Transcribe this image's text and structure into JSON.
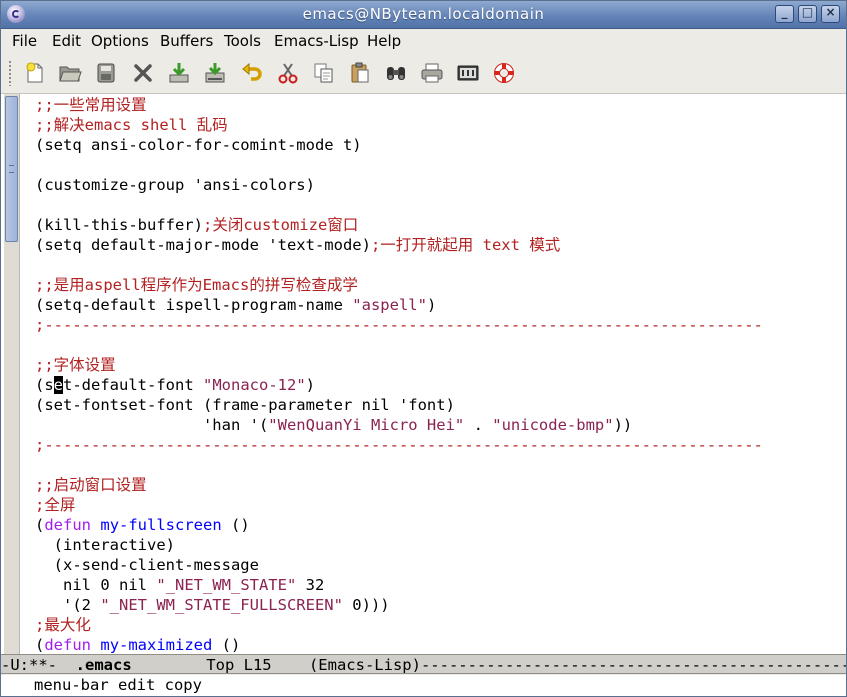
{
  "window": {
    "title": "emacs@NByteam.localdomain"
  },
  "menubar": [
    "File",
    "Edit",
    "Options",
    "Buffers",
    "Tools",
    "Emacs-Lisp",
    "Help"
  ],
  "toolbar": [
    {
      "name": "new-file-icon"
    },
    {
      "name": "open-folder-icon"
    },
    {
      "name": "save-icon"
    },
    {
      "name": "close-icon"
    },
    {
      "name": "save-download-icon"
    },
    {
      "name": "save-as-icon"
    },
    {
      "name": "undo-icon"
    },
    {
      "name": "cut-icon"
    },
    {
      "name": "copy-icon"
    },
    {
      "name": "paste-icon"
    },
    {
      "name": "search-binoculars-icon"
    },
    {
      "name": "print-icon"
    },
    {
      "name": "preferences-icon"
    },
    {
      "name": "help-lifebuoy-icon"
    }
  ],
  "code_lines": [
    [
      {
        "t": ";;一些常用设置",
        "c": "c"
      }
    ],
    [
      {
        "t": ";;解决emacs shell 乱码",
        "c": "c"
      }
    ],
    [
      {
        "t": "(setq ansi-color-for-comint-mode t)",
        "c": ""
      }
    ],
    [],
    [
      {
        "t": "(customize-group 'ansi-colors)",
        "c": ""
      }
    ],
    [],
    [
      {
        "t": "(kill-this-buffer)",
        "c": ""
      },
      {
        "t": ";关闭customize窗口",
        "c": "c"
      }
    ],
    [
      {
        "t": "(setq default-major-mode 'text-mode)",
        "c": ""
      },
      {
        "t": ";一打开就起用 text 模式",
        "c": "c"
      }
    ],
    [],
    [
      {
        "t": ";;是用aspell程序作为Emacs的拼写检查成学",
        "c": "c"
      }
    ],
    [
      {
        "t": "(setq-default ispell-program-name ",
        "c": ""
      },
      {
        "t": "\"aspell\"",
        "c": "s"
      },
      {
        "t": ")",
        "c": ""
      }
    ],
    [
      {
        "t": ";-----------------------------------------------------------------------------",
        "c": "c"
      }
    ],
    [],
    [
      {
        "t": ";;字体设置",
        "c": "c"
      }
    ],
    [
      {
        "t": "(s",
        "c": ""
      },
      {
        "t": "e",
        "c": "cursor"
      },
      {
        "t": "t-default-font ",
        "c": ""
      },
      {
        "t": "\"Monaco-12\"",
        "c": "s"
      },
      {
        "t": ")",
        "c": ""
      }
    ],
    [
      {
        "t": "(set-fontset-font (frame-parameter nil 'font)",
        "c": ""
      }
    ],
    [
      {
        "t": "                  'han '(",
        "c": ""
      },
      {
        "t": "\"WenQuanYi Micro Hei\"",
        "c": "s"
      },
      {
        "t": " . ",
        "c": ""
      },
      {
        "t": "\"unicode-bmp\"",
        "c": "s"
      },
      {
        "t": "))",
        "c": ""
      }
    ],
    [
      {
        "t": ";-----------------------------------------------------------------------------",
        "c": "c"
      }
    ],
    [],
    [
      {
        "t": ";;启动窗口设置",
        "c": "c"
      }
    ],
    [
      {
        "t": ";全屏",
        "c": "c"
      }
    ],
    [
      {
        "t": "(",
        "c": ""
      },
      {
        "t": "defun",
        "c": "k"
      },
      {
        "t": " ",
        "c": ""
      },
      {
        "t": "my-fullscreen",
        "c": "f"
      },
      {
        "t": " ()",
        "c": ""
      }
    ],
    [
      {
        "t": "  (interactive)",
        "c": ""
      }
    ],
    [
      {
        "t": "  (x-send-client-message",
        "c": ""
      }
    ],
    [
      {
        "t": "   nil 0 nil ",
        "c": ""
      },
      {
        "t": "\"_NET_WM_STATE\"",
        "c": "s"
      },
      {
        "t": " 32",
        "c": ""
      }
    ],
    [
      {
        "t": "   '(2 ",
        "c": ""
      },
      {
        "t": "\"_NET_WM_STATE_FULLSCREEN\"",
        "c": "s"
      },
      {
        "t": " 0)))",
        "c": ""
      }
    ],
    [
      {
        "t": ";最大化",
        "c": "c"
      }
    ],
    [
      {
        "t": "(",
        "c": ""
      },
      {
        "t": "defun",
        "c": "k"
      },
      {
        "t": " ",
        "c": ""
      },
      {
        "t": "my-maximized",
        "c": "f"
      },
      {
        "t": " ()",
        "c": ""
      }
    ]
  ],
  "modeline": {
    "status": "-U:**-  ",
    "buffer": ".emacs",
    "position": "        Top L15    ",
    "mode": "(Emacs-Lisp)",
    "fill": "------------------------------------------------------"
  },
  "echo_area": "menu-bar edit copy"
}
